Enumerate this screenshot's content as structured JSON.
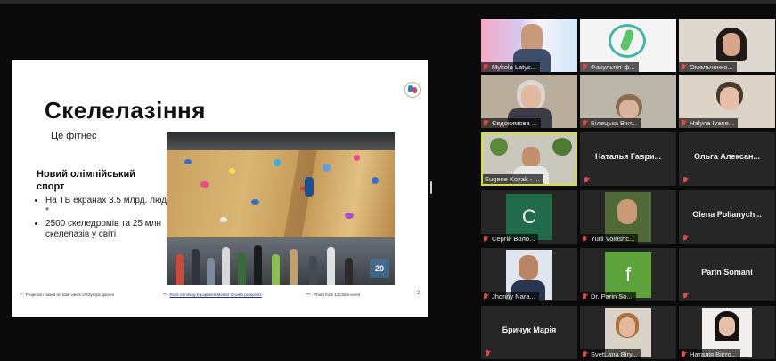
{
  "slide": {
    "title": "Скелелазіння",
    "subtitle": "Це фітнес",
    "heading": "Новий олімпійський спорт",
    "bullets": [
      "На ТВ екранах 3.5 млрд. людей *",
      "2500 скеледромів та 25 млн скелелазів у світі"
    ],
    "footnote_1": "* - Projection based on total views of Olympic games",
    "footnote_2_prefix": "** - ",
    "footnote_2_link": "Rock Climbing Equipment Market Growth prospects",
    "footnote_3": "*** - Photo from 12Climb event",
    "page_number": "2",
    "photo_badge": "20"
  },
  "participants": [
    {
      "name": "Mykola Latys...",
      "muted": true
    },
    {
      "name": "Факультет ф...",
      "muted": true
    },
    {
      "name": "Омельченко...",
      "muted": true
    },
    {
      "name": "Євдокимова ...",
      "muted": true
    },
    {
      "name": "Білецька Вікт...",
      "muted": true
    },
    {
      "name": "Halyna Ivane...",
      "muted": true
    },
    {
      "name": "Eugene Kozak - ...",
      "muted": false,
      "active": true
    },
    {
      "name": "Наталья Гаври...",
      "muted": true
    },
    {
      "name": "Ольга Алексан...",
      "muted": true
    },
    {
      "name": "Сергій Воло...",
      "muted": true,
      "initial": "C"
    },
    {
      "name": "Yurii Voloshc...",
      "muted": true
    },
    {
      "name": "Olena Polianych...",
      "muted": true
    },
    {
      "name": "Jhonny Nara...",
      "muted": true
    },
    {
      "name": "Dr. Parin So...",
      "muted": true,
      "initial": "f"
    },
    {
      "name": "Parin Somani",
      "muted": true
    },
    {
      "name": "Бричук Марія",
      "muted": true
    },
    {
      "name": "SvetLana Biry...",
      "muted": true
    },
    {
      "name": "Наталія Вікто...",
      "muted": true
    }
  ],
  "colors": {
    "active_border": "#d7e22c",
    "muted_icon": "#e24a4a",
    "tile_bg": "#262626"
  }
}
